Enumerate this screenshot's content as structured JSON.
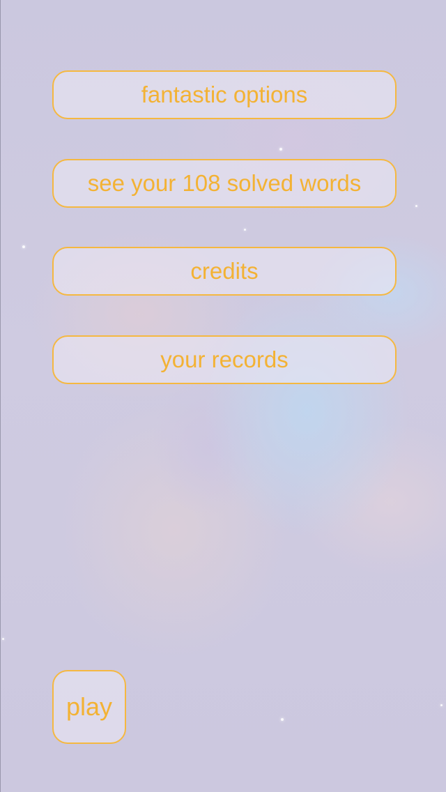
{
  "menu": {
    "options_label": "fantastic options",
    "solved_words_label": "see your 108 solved words",
    "credits_label": "credits",
    "records_label": "your records"
  },
  "play": {
    "label": "play"
  },
  "colors": {
    "accent": "#f3b234",
    "border": "#f5b840",
    "background": "#cdc9e0"
  }
}
